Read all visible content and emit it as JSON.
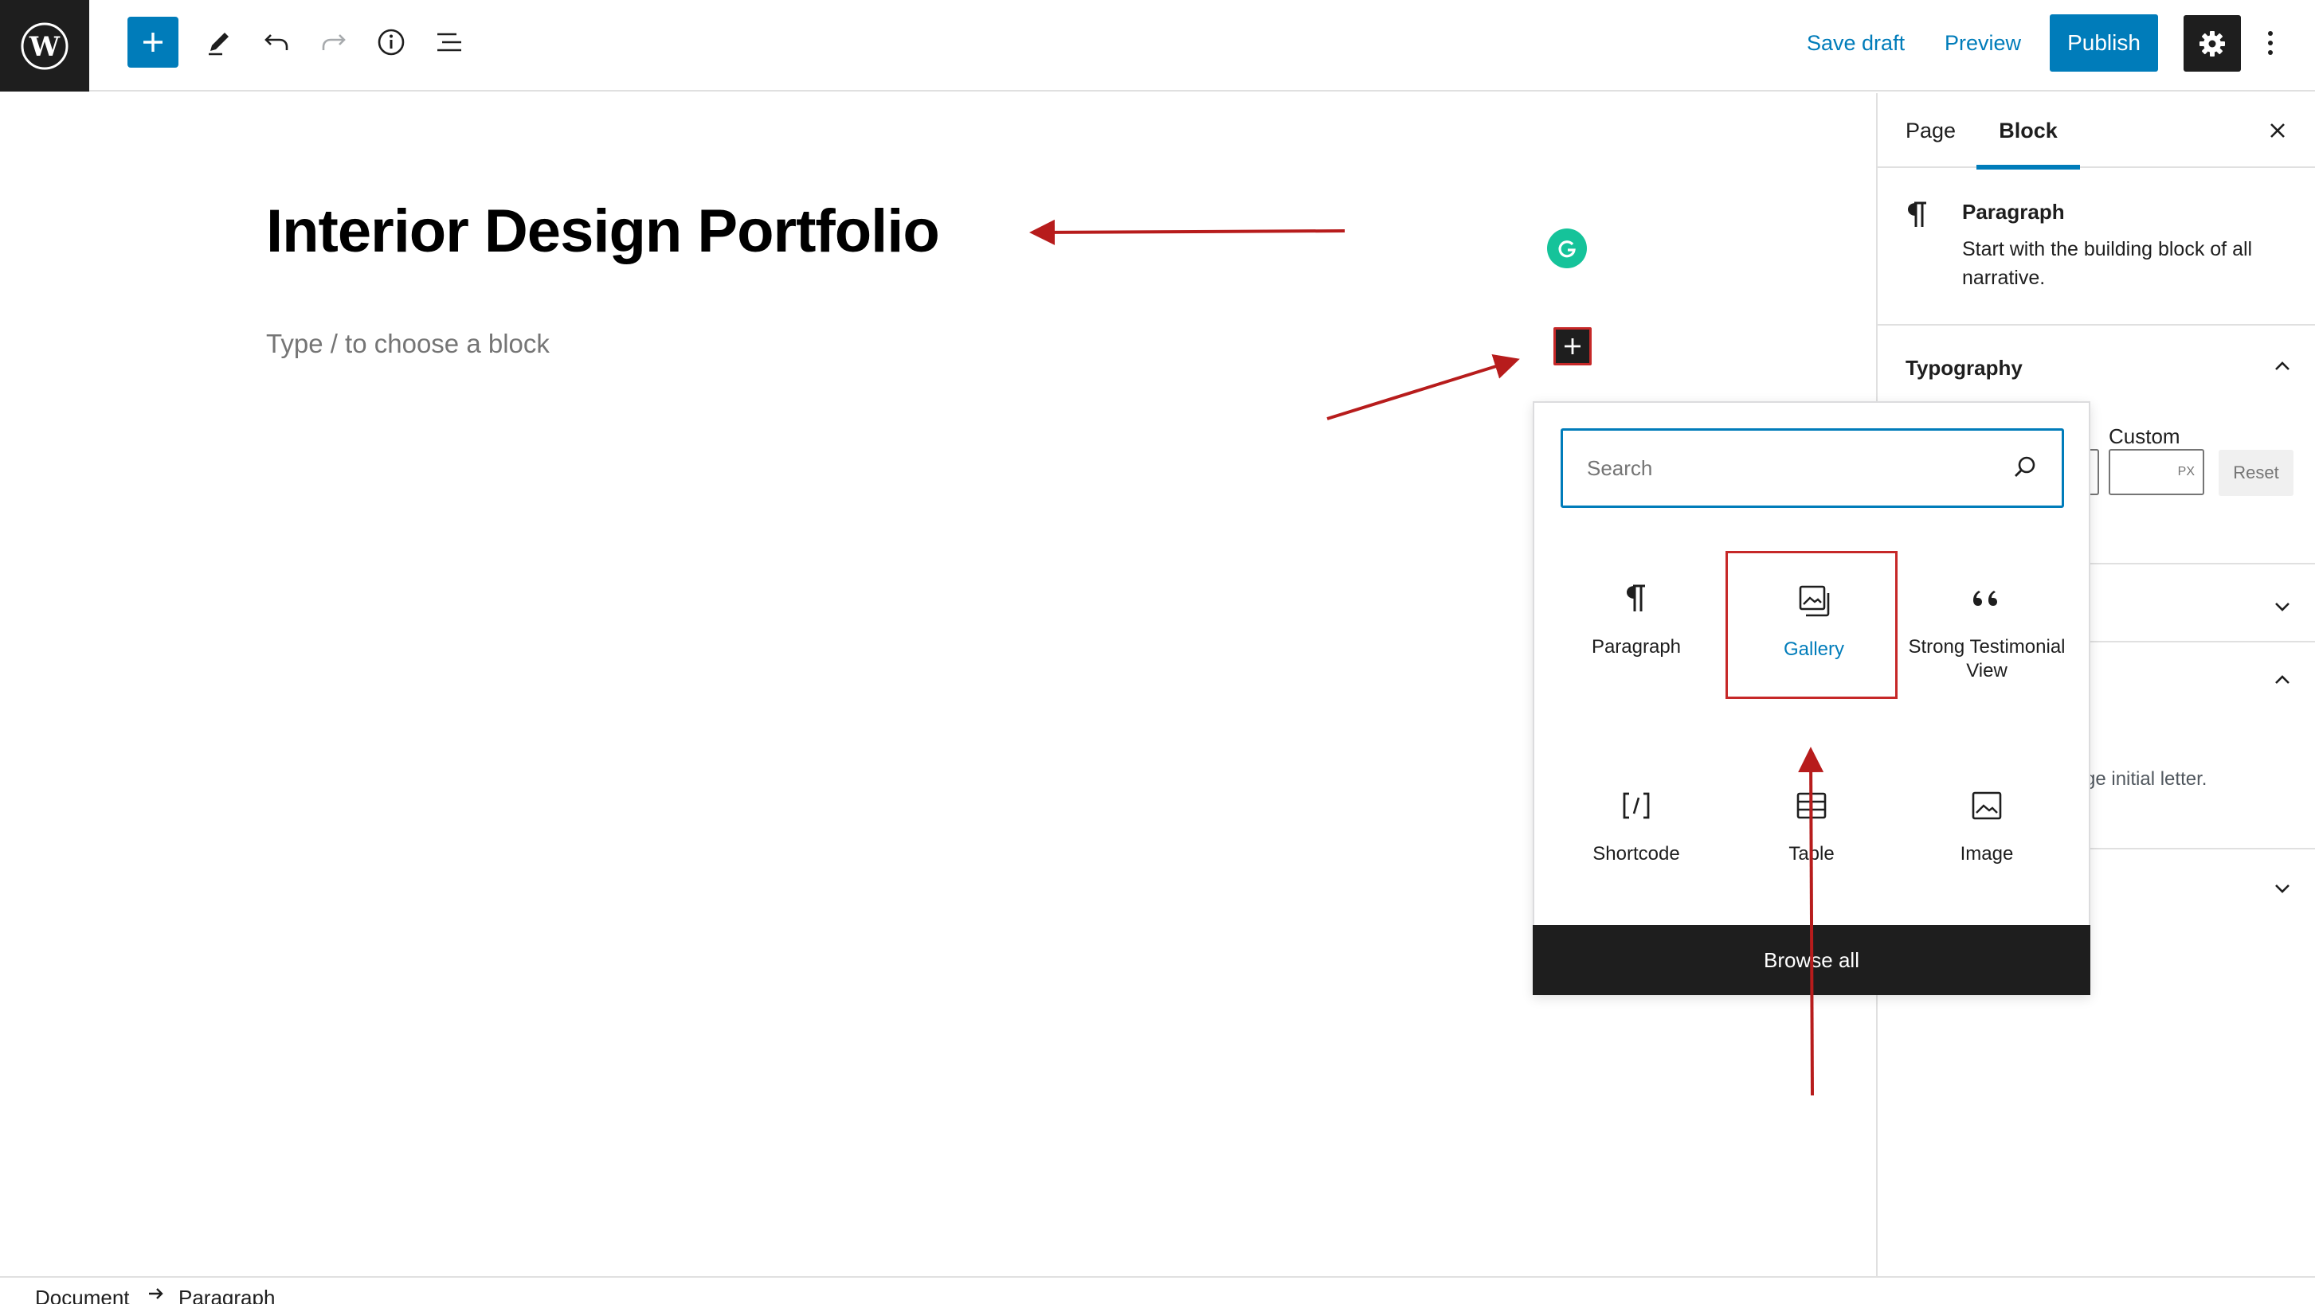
{
  "topbar": {
    "save_draft": "Save draft",
    "preview": "Preview",
    "publish": "Publish",
    "icons": [
      "wordpress-logo-icon",
      "plus-icon",
      "pencil-icon",
      "undo-icon",
      "redo-icon",
      "info-icon",
      "list-view-icon",
      "gear-icon",
      "more-vertical-icon"
    ],
    "accent_color": "#007cba"
  },
  "editor": {
    "title": "Interior Design Portfolio",
    "placeholder": "Type / to choose a block"
  },
  "inserter": {
    "search_placeholder": "Search",
    "items": [
      {
        "label": "Paragraph",
        "icon": "paragraph-icon"
      },
      {
        "label": "Gallery",
        "icon": "gallery-icon",
        "highlighted": true
      },
      {
        "label": "Strong Testimonial View",
        "icon": "quote-icon"
      },
      {
        "label": "Shortcode",
        "icon": "shortcode-icon"
      },
      {
        "label": "Table",
        "icon": "table-icon"
      },
      {
        "label": "Image",
        "icon": "image-icon"
      }
    ],
    "browse_all": "Browse all"
  },
  "sidebar": {
    "tabs": [
      {
        "label": "Page"
      },
      {
        "label": "Block",
        "active": true
      }
    ],
    "block_card": {
      "title": "Paragraph",
      "description": "Start with the building block of all narrative."
    },
    "typography": {
      "title": "Typography",
      "custom_label": "Custom",
      "unit": "PX",
      "reset": "Reset"
    },
    "partial_text": "ge initial letter."
  },
  "footer": {
    "breadcrumb": [
      "Document",
      "Paragraph"
    ]
  },
  "annotation_color": "#b71c1c"
}
